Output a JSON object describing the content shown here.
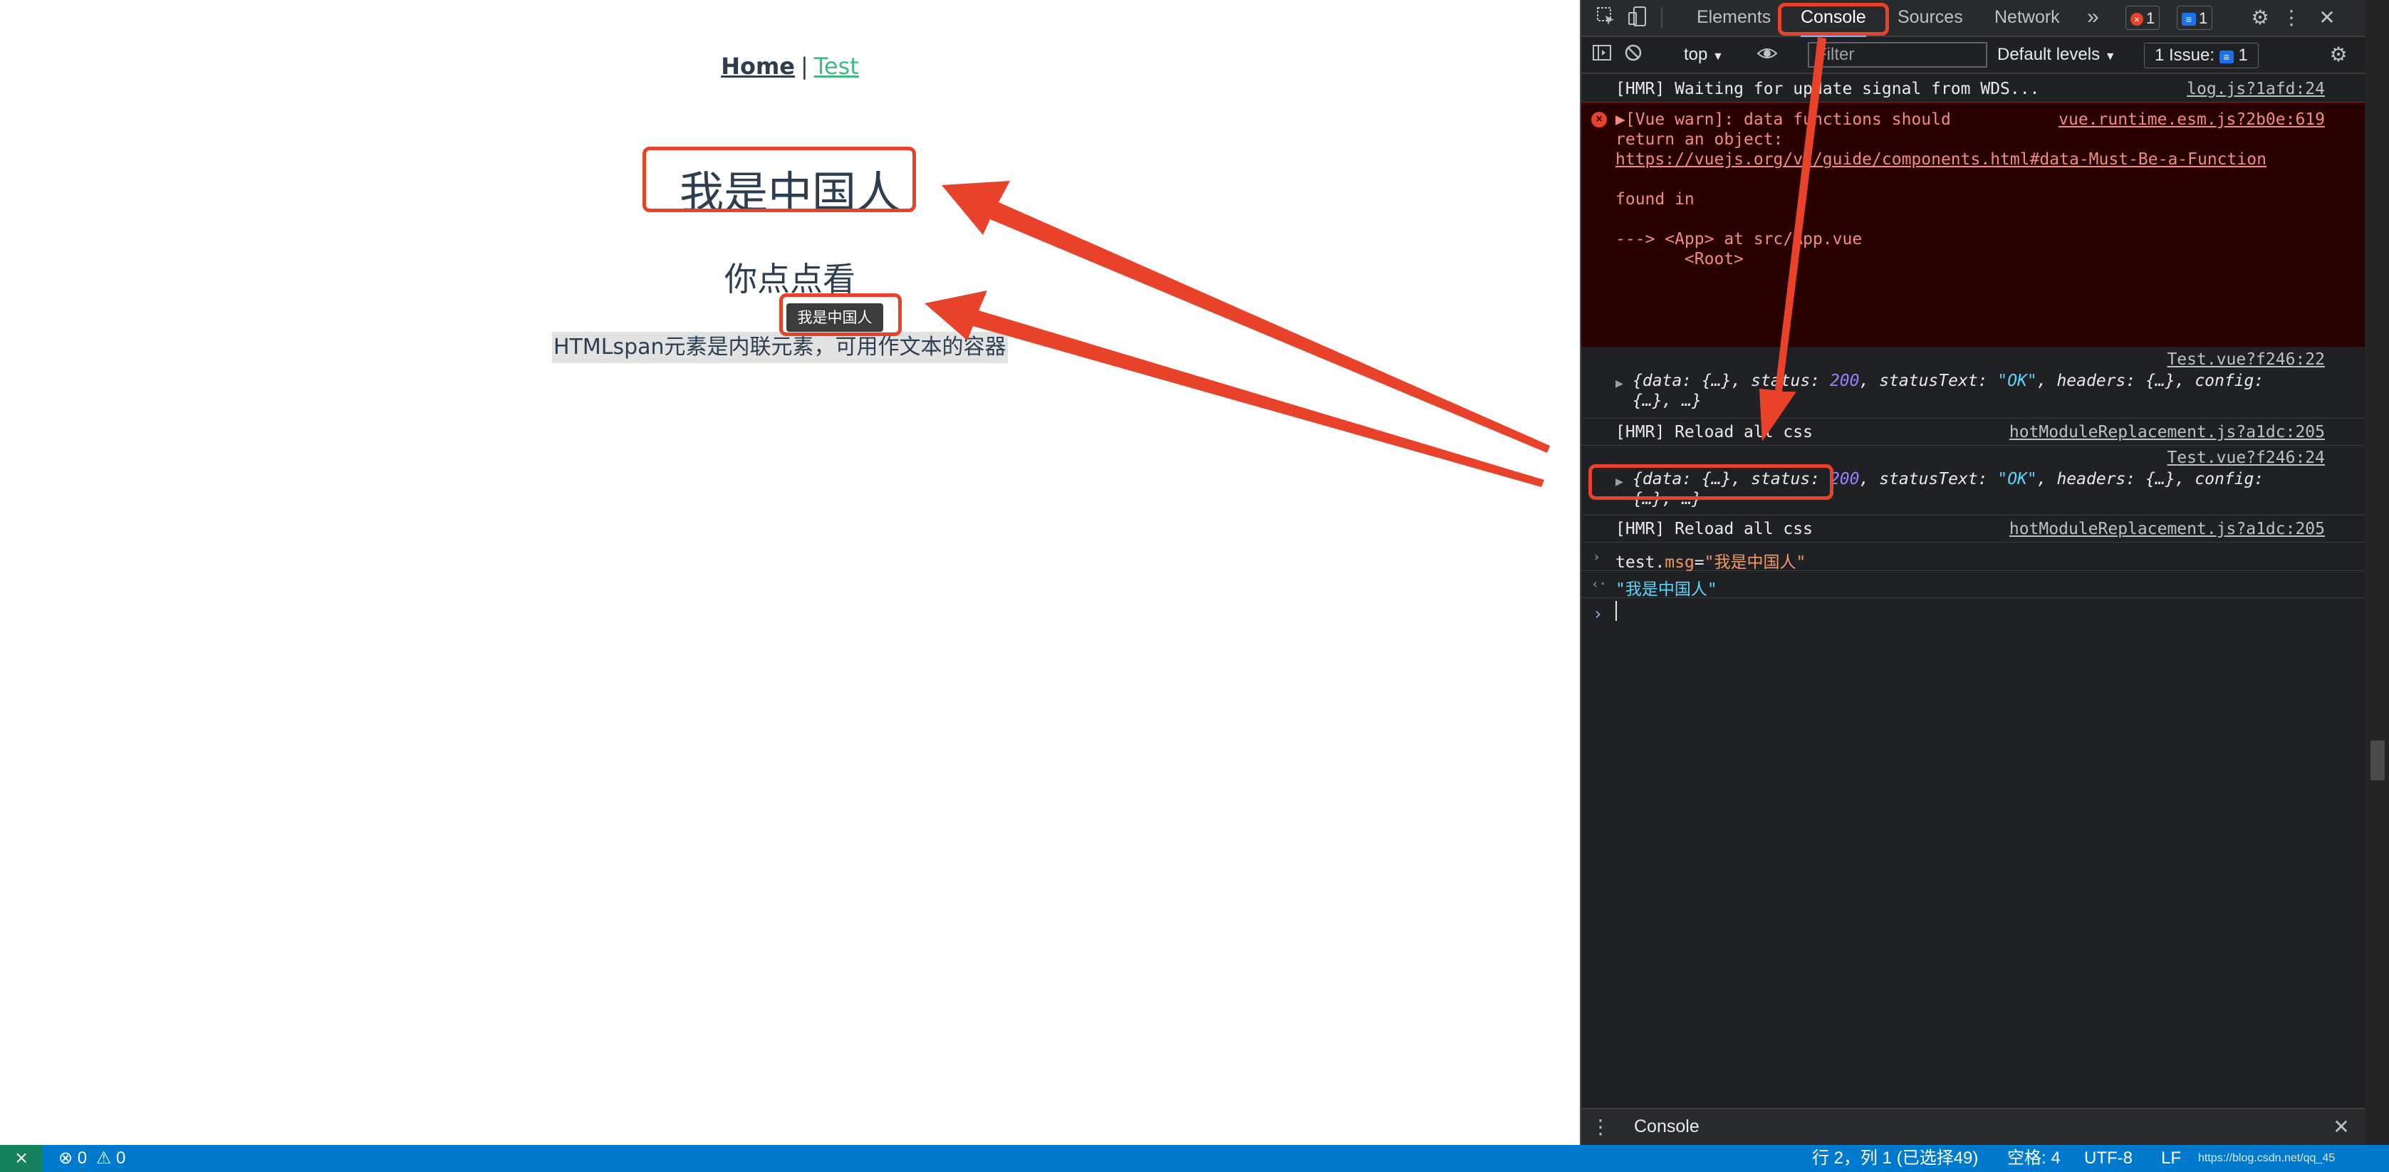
{
  "app": {
    "nav_home": "Home",
    "nav_sep": "|",
    "nav_test": "Test",
    "msg_heading": "我是中国人",
    "click_text": "你点点看",
    "tooltip": "我是中国人",
    "span_text": "HTMLspan元素是内联元素，可用作文本的容器"
  },
  "devtools": {
    "tabs": [
      "Elements",
      "Console",
      "Sources",
      "Network"
    ],
    "active_tab": "Console",
    "more_tabs_icon": "»",
    "error_count": "1",
    "message_count": "1",
    "context": "top",
    "filter_placeholder": "Filter",
    "levels": "Default levels",
    "issues_label": "1 Issue:",
    "issues_count": "1",
    "console_rows": {
      "hmr_wait": {
        "text": "[HMR] Waiting for update signal from WDS...",
        "src": "log.js?1afd:24"
      },
      "vue_warn": {
        "line1": "▶[Vue warn]: data functions should",
        "src": "vue.runtime.esm.js?2b0e:619",
        "line2": "return an object:",
        "link": "https://vuejs.org/v2/guide/components.html#data-Must-Be-a-Function",
        "found": "found in",
        "trace1": "---> <App> at src/App.vue",
        "trace2": "       <Root>"
      },
      "log1": {
        "src": "Test.vue?f246:22",
        "data": "{data: {…}, status: ",
        "status": "200",
        "mid": ", statusText: ",
        "statusText": "\"OK\"",
        "tail": ", headers: {…}, config:",
        "line2": "{…}, …}"
      },
      "hmr_reload1": {
        "text": "[HMR] Reload all css",
        "src": "hotModuleReplacement.js?a1dc:205"
      },
      "log2": {
        "src": "Test.vue?f246:24",
        "data": "{data: {…}, status: ",
        "status": "200",
        "mid": ", statusText: ",
        "statusText": "\"OK\"",
        "tail": ", headers: {…}, config:",
        "line2": "{…}, …}"
      },
      "hmr_reload2": {
        "text": "[HMR] Reload all css",
        "src": "hotModuleReplacement.js?a1dc:205"
      },
      "input_cmd": {
        "obj": "test.",
        "prop": "msg",
        "eq": "=",
        "value": "\"我是中国人\""
      },
      "result": "\"我是中国人\""
    },
    "drawer_tab": "Console"
  },
  "statusbar": {
    "errors": "0",
    "warnings": "0",
    "position": "行 2，列 1 (已选择49)",
    "spaces": "空格: 4",
    "encoding": "UTF-8",
    "eol": "LF",
    "watermark": "https://blog.csdn.net/qq_45"
  },
  "colors": {
    "annotation_red": "#e8432a",
    "vue_green": "#42b983",
    "statusbar_blue": "#007acc"
  }
}
